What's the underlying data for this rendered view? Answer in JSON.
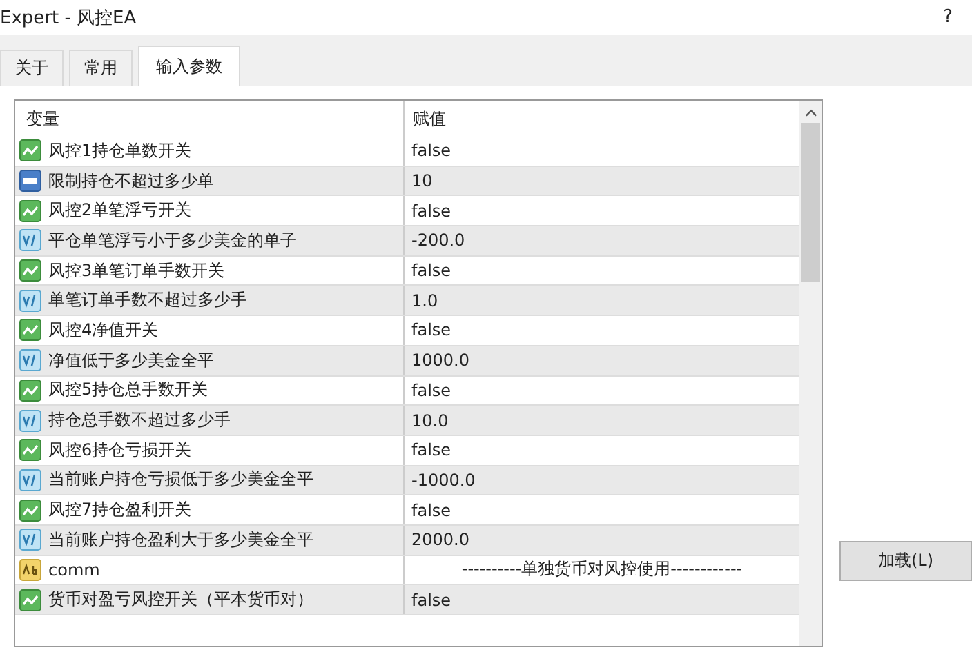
{
  "window": {
    "title": "Expert - 风控EA",
    "help": "?"
  },
  "tabs": [
    {
      "label": "关于",
      "selected": false
    },
    {
      "label": "常用",
      "selected": false
    },
    {
      "label": "输入参数",
      "selected": true
    }
  ],
  "table": {
    "columns": [
      "变量",
      "赋值"
    ],
    "rows": [
      {
        "kind": "bool",
        "name": "风控1持仓单数开关",
        "value": "false"
      },
      {
        "kind": "int",
        "name": "限制持仓不超过多少单",
        "value": "10"
      },
      {
        "kind": "bool",
        "name": "风控2单笔浮亏开关",
        "value": "false"
      },
      {
        "kind": "double",
        "name": "平仓单笔浮亏小于多少美金的单子",
        "value": "-200.0"
      },
      {
        "kind": "bool",
        "name": "风控3单笔订单手数开关",
        "value": "false"
      },
      {
        "kind": "double",
        "name": "单笔订单手数不超过多少手",
        "value": "1.0"
      },
      {
        "kind": "bool",
        "name": "风控4净值开关",
        "value": "false"
      },
      {
        "kind": "double",
        "name": "净值低于多少美金全平",
        "value": "1000.0"
      },
      {
        "kind": "bool",
        "name": "风控5持仓总手数开关",
        "value": "false"
      },
      {
        "kind": "double",
        "name": "持仓总手数不超过多少手",
        "value": "10.0"
      },
      {
        "kind": "bool",
        "name": "风控6持仓亏损开关",
        "value": "false"
      },
      {
        "kind": "double",
        "name": "当前账户持仓亏损低于多少美金全平",
        "value": "-1000.0"
      },
      {
        "kind": "bool",
        "name": "风控7持仓盈利开关",
        "value": "false"
      },
      {
        "kind": "double",
        "name": "当前账户持仓盈利大于多少美金全平",
        "value": "2000.0"
      },
      {
        "kind": "string",
        "name": "comm",
        "value": "----------单独货币对风控使用------------"
      },
      {
        "kind": "bool",
        "name": "货币对盈亏风控开关（平本货币对）",
        "value": "false"
      }
    ]
  },
  "buttons": [
    "加载(L)"
  ]
}
